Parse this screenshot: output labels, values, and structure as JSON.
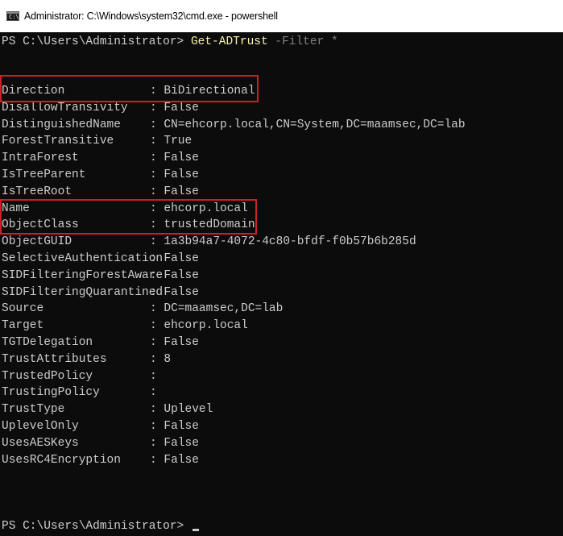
{
  "window": {
    "title": "Administrator: C:\\Windows\\system32\\cmd.exe - powershell",
    "icon": "cmd-console-icon",
    "icon_glyph": "C:\\"
  },
  "colors": {
    "background": "#0c0c0c",
    "text": "#cccccc",
    "command": "#f9f1a5",
    "parameter": "#808080",
    "highlight_box": "#cc1f27"
  },
  "command_line": {
    "prompt": "PS C:\\Users\\Administrator> ",
    "cmdlet": "Get-ADTrust",
    "parameter": " -Filter",
    "argument": " *"
  },
  "properties": [
    {
      "name": "Direction",
      "value": "BiDirectional"
    },
    {
      "name": "DisallowTransivity",
      "value": "False"
    },
    {
      "name": "DistinguishedName",
      "value": "CN=ehcorp.local,CN=System,DC=maamsec,DC=lab"
    },
    {
      "name": "ForestTransitive",
      "value": "True"
    },
    {
      "name": "IntraForest",
      "value": "False"
    },
    {
      "name": "IsTreeParent",
      "value": "False"
    },
    {
      "name": "IsTreeRoot",
      "value": "False"
    },
    {
      "name": "Name",
      "value": "ehcorp.local"
    },
    {
      "name": "ObjectClass",
      "value": "trustedDomain"
    },
    {
      "name": "ObjectGUID",
      "value": "1a3b94a7-4072-4c80-bfdf-f0b57b6b285d"
    },
    {
      "name": "SelectiveAuthentication",
      "value": "False"
    },
    {
      "name": "SIDFilteringForestAware",
      "value": "False"
    },
    {
      "name": "SIDFilteringQuarantined",
      "value": "False"
    },
    {
      "name": "Source",
      "value": "DC=maamsec,DC=lab"
    },
    {
      "name": "Target",
      "value": "ehcorp.local"
    },
    {
      "name": "TGTDelegation",
      "value": "False"
    },
    {
      "name": "TrustAttributes",
      "value": "8"
    },
    {
      "name": "TrustedPolicy",
      "value": ""
    },
    {
      "name": "TrustingPolicy",
      "value": ""
    },
    {
      "name": "TrustType",
      "value": "Uplevel"
    },
    {
      "name": "UplevelOnly",
      "value": "False"
    },
    {
      "name": "UsesAESKeys",
      "value": "False"
    },
    {
      "name": "UsesRC4Encryption",
      "value": "False"
    }
  ],
  "separator": ": ",
  "final_prompt": "PS C:\\Users\\Administrator> "
}
